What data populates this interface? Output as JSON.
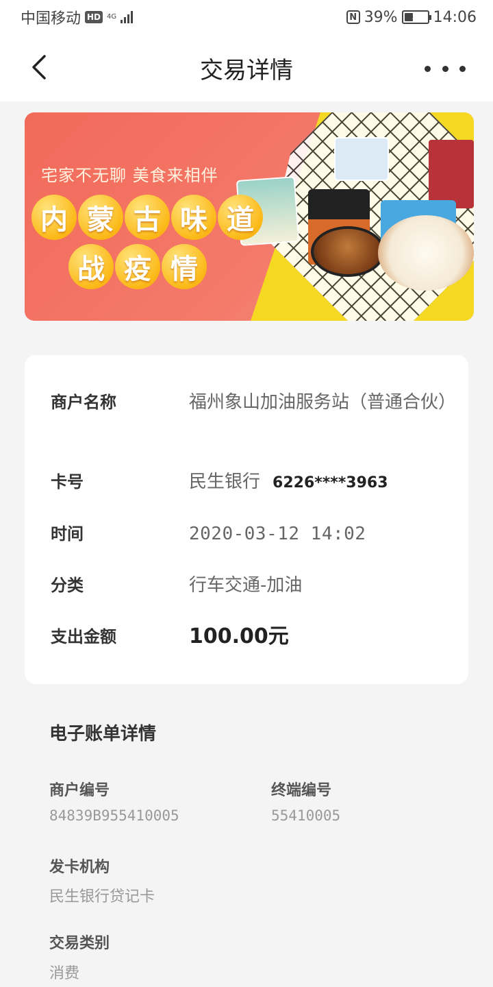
{
  "status_bar": {
    "carrier": "中国移动",
    "hd": "HD",
    "network": "4G",
    "nfc": "N",
    "battery": "39%",
    "battery_level": 0.39,
    "time": "14:06"
  },
  "nav": {
    "title": "交易详情"
  },
  "banner": {
    "slogan": "宅家不无聊 美食来相伴",
    "line1": [
      "内",
      "蒙",
      "古",
      "味",
      "道"
    ],
    "line2": [
      "战",
      "疫",
      "情"
    ]
  },
  "transaction": {
    "merchant_label": "商户名称",
    "merchant_value": "福州象山加油服务站（普通合伙）",
    "card_label": "卡号",
    "card_bank": "民生银行",
    "card_number": "6226****3963",
    "time_label": "时间",
    "time_value": "2020-03-12 14:02",
    "category_label": "分类",
    "category_value": "行车交通-加油",
    "amount_label": "支出金额",
    "amount_value": "100.00元"
  },
  "bill": {
    "title": "电子账单详情",
    "merchant_no_label": "商户编号",
    "merchant_no_value": "84839B955410005",
    "terminal_no_label": "终端编号",
    "terminal_no_value": "55410005",
    "issuer_label": "发卡机构",
    "issuer_value": "民生银行贷记卡",
    "type_label": "交易类别",
    "type_value": "消费"
  }
}
